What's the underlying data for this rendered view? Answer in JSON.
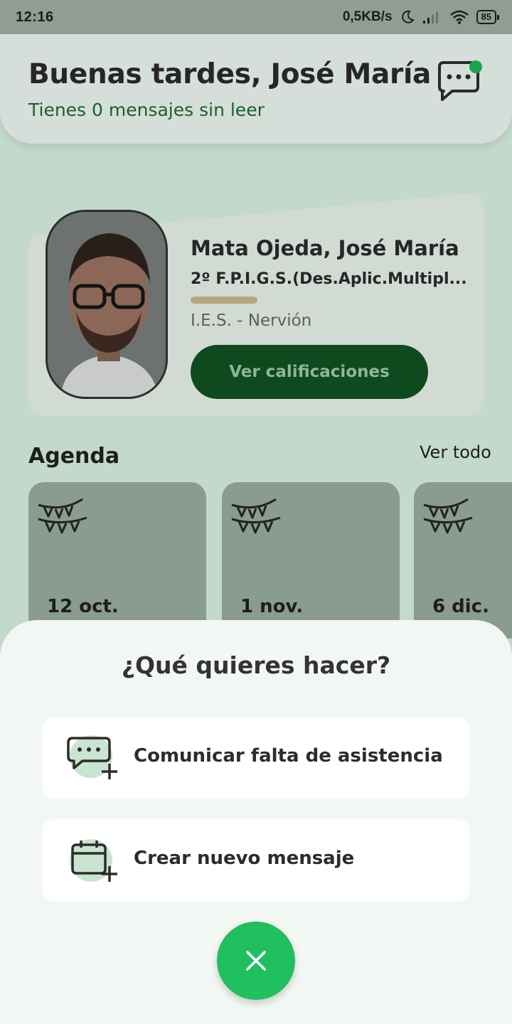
{
  "status_bar": {
    "time": "12:16",
    "network_speed": "0,5KB/s",
    "battery": "85"
  },
  "header": {
    "greeting": "Buenas tardes, José María",
    "unread_text": "Tienes 0 mensajes sin leer"
  },
  "student": {
    "name": "Mata Ojeda, José María",
    "course": "2º F.P.I.G.S.(Des.Aplic.Multipl...",
    "school": "I.E.S. - Nervión",
    "grades_button": "Ver calificaciones"
  },
  "agenda": {
    "title": "Agenda",
    "see_all": "Ver todo",
    "events": [
      {
        "date": "12 oct.",
        "icon": "garland-icon"
      },
      {
        "date": "1 nov.",
        "icon": "garland-icon"
      },
      {
        "date": "6 dic.",
        "icon": "garland-icon"
      }
    ]
  },
  "sheet": {
    "title": "¿Qué quieres hacer?",
    "options": [
      {
        "label": "Comunicar falta de asistencia",
        "icon": "chat-add-icon"
      },
      {
        "label": "Crear nuevo mensaje",
        "icon": "calendar-add-icon"
      }
    ],
    "close_icon": "close-icon"
  },
  "colors": {
    "accent_green": "#22bf5f",
    "dark_green": "#0f4a1f",
    "notification_dot": "#1aa24d"
  }
}
